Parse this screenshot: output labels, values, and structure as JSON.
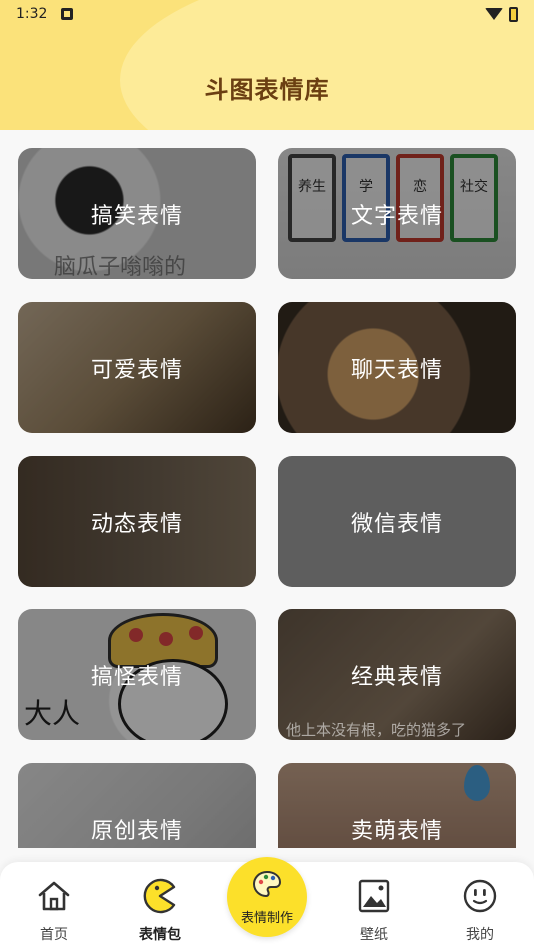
{
  "status_bar": {
    "time": "1:32"
  },
  "header": {
    "title": "斗图表情库"
  },
  "categories": [
    {
      "label": "搞笑表情"
    },
    {
      "label": "文字表情"
    },
    {
      "label": "可爱表情"
    },
    {
      "label": "聊天表情"
    },
    {
      "label": "动态表情"
    },
    {
      "label": "微信表情"
    },
    {
      "label": "搞怪表情"
    },
    {
      "label": "经典表情"
    },
    {
      "label": "原创表情"
    },
    {
      "label": "卖萌表情"
    }
  ],
  "card_text": {
    "panda_caption": "脑瓜子嗡嗡的",
    "cups": [
      "养生",
      "学",
      "恋",
      "社交"
    ],
    "guai_caption": "大人",
    "classic_caption": "他上本没有根，吃的猫多了"
  },
  "tabbar": {
    "home": "首页",
    "packs": "表情包",
    "make": "表情制作",
    "wallpaper": "壁纸",
    "mine": "我的"
  },
  "colors": {
    "header_bg": "#fbe27a",
    "title": "#6b3f12",
    "center_button": "#fce02a"
  },
  "icons": [
    "home-icon",
    "pacman-icon",
    "palette-icon",
    "picture-icon",
    "smiley-icon"
  ]
}
